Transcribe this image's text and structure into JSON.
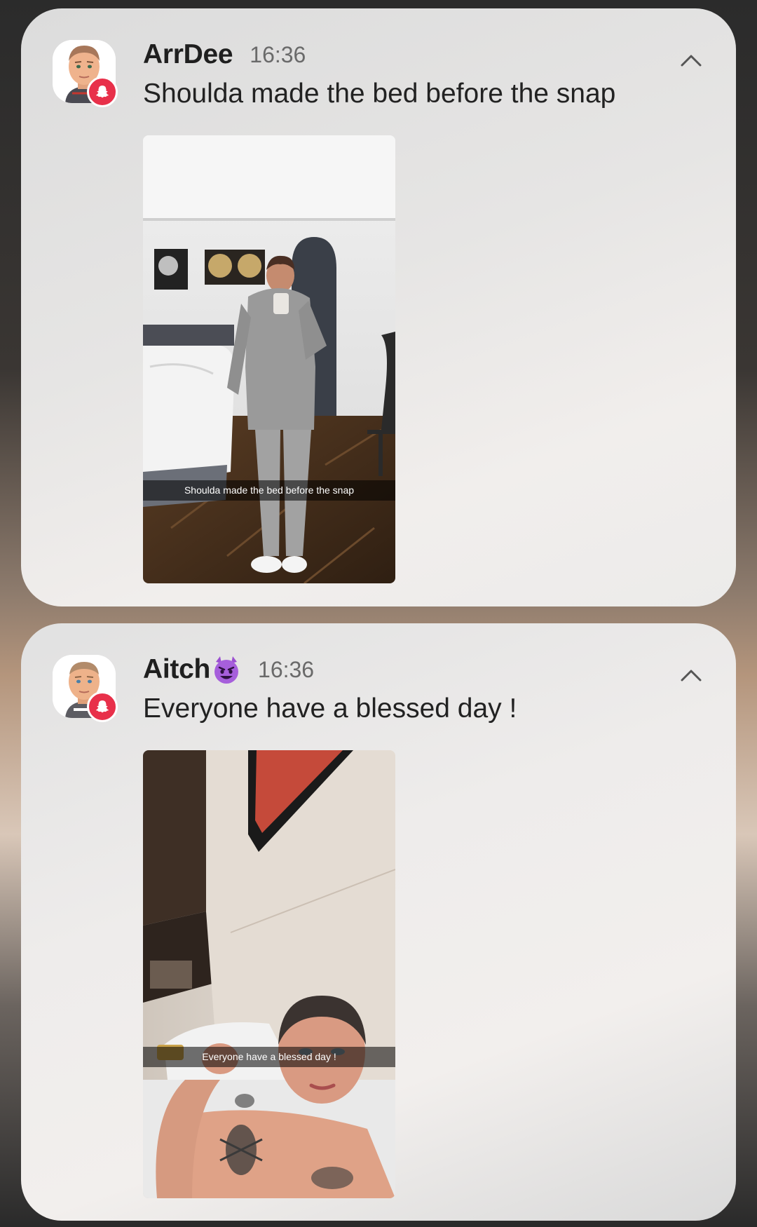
{
  "notifications": [
    {
      "sender": "ArrDee",
      "time": "16:36",
      "message": "Shoulda made the bed before the snap",
      "caption": "Shoulda made the bed before the snap",
      "app_icon": "snapchat-ghost-icon",
      "avatar": "bitmoji-avatar",
      "expand_icon": "chevron-up-icon"
    },
    {
      "sender": "Aitch",
      "sender_emoji": "smiling-imp-emoji",
      "time": "16:36",
      "message": "Everyone have a blessed day !",
      "caption": "Everyone have a blessed day !",
      "app_icon": "snapchat-ghost-icon",
      "avatar": "bitmoji-avatar",
      "expand_icon": "chevron-up-icon"
    }
  ],
  "colors": {
    "badge": "#e8304a",
    "card_background": "#e6e5e4",
    "sender_text": "#1f1f1f",
    "time_text": "#6a6a6a"
  }
}
